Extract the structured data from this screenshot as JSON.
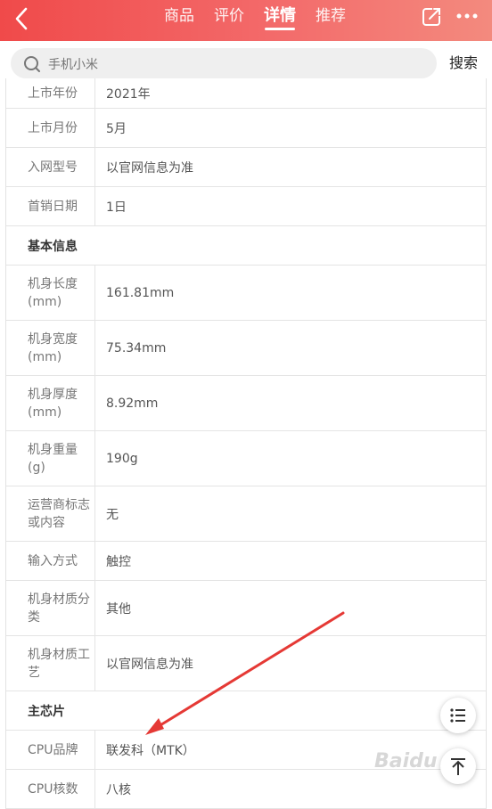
{
  "header": {
    "tabs": [
      {
        "label": "商品"
      },
      {
        "label": "评价"
      },
      {
        "label": "详情"
      },
      {
        "label": "推荐"
      }
    ],
    "active_tab": "详情",
    "colors": {
      "accent": "#f04a4a"
    }
  },
  "search": {
    "placeholder": "手机小米",
    "button_label": "搜索"
  },
  "table": {
    "rows": [
      {
        "label": "上市年份",
        "value": "2021年"
      },
      {
        "label": "上市月份",
        "value": "5月"
      },
      {
        "label": "入网型号",
        "value": "以官网信息为准"
      },
      {
        "label": "首销日期",
        "value": "1日"
      },
      {
        "section": "基本信息"
      },
      {
        "label": "机身长度(mm)",
        "value": "161.81mm"
      },
      {
        "label": "机身宽度(mm)",
        "value": "75.34mm"
      },
      {
        "label": "机身厚度(mm)",
        "value": "8.92mm"
      },
      {
        "label": "机身重量(g)",
        "value": "190g"
      },
      {
        "label": "运营商标志或内容",
        "value": "无"
      },
      {
        "label": "输入方式",
        "value": "触控"
      },
      {
        "label": "机身材质分类",
        "value": "其他"
      },
      {
        "label": "机身材质工艺",
        "value": "以官网信息为准"
      },
      {
        "section": "主芯片"
      },
      {
        "label": "CPU品牌",
        "value": "联发科（MTK）"
      },
      {
        "label": "CPU核数",
        "value": "八核"
      }
    ]
  },
  "icons": {
    "back": "back-chevron-icon",
    "share": "share-icon",
    "more": "more-dots-icon",
    "search": "search-icon",
    "list": "list-icon",
    "top": "back-to-top-icon"
  },
  "watermark": {
    "text": "Baidu"
  }
}
